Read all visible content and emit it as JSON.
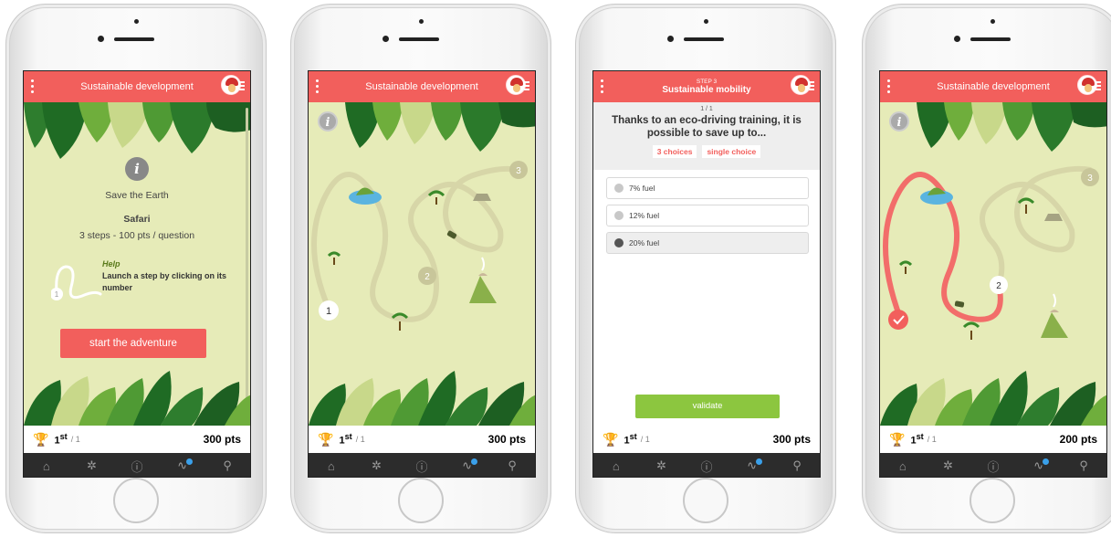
{
  "colors": {
    "accent": "#f25f5c",
    "scene": "#e6ebb8",
    "validate": "#8cc63f",
    "path_done": "#f26d6a"
  },
  "icons": {
    "menu": "menu-dots-icon",
    "avatar": "avatar-icon",
    "info": "info-icon",
    "trophy": "trophy-icon",
    "nav": [
      "home-icon",
      "network-icon",
      "help-icon",
      "activity-icon",
      "search-icon"
    ]
  },
  "screens": {
    "intro": {
      "header_title": "Sustainable development",
      "line1": "Save the Earth",
      "line2": "Safari",
      "line3": "3 steps - 100 pts / question",
      "help_title": "Help",
      "help_text": "Launch a step by clicking on its number",
      "help_step": "1",
      "start_button": "start the adventure",
      "rank": "1",
      "rank_suffix": "st",
      "rank_total": "/ 1",
      "points": "300 pts"
    },
    "map": {
      "header_title": "Sustainable development",
      "steps": [
        "1",
        "2",
        "3"
      ],
      "rank": "1",
      "rank_suffix": "st",
      "rank_total": "/ 1",
      "points": "300 pts"
    },
    "quiz": {
      "step_label": "STEP 3",
      "header_title": "Sustainable mobility",
      "counter": "1 / 1",
      "question": "Thanks to an eco-driving training, it is possible to save up to...",
      "tags": [
        "3 choices",
        "single choice"
      ],
      "options": [
        {
          "label": "7% fuel",
          "selected": false
        },
        {
          "label": "12% fuel",
          "selected": false
        },
        {
          "label": "20% fuel",
          "selected": true
        }
      ],
      "validate_button": "validate",
      "rank": "1",
      "rank_suffix": "st",
      "rank_total": "/ 1",
      "points": "300 pts"
    },
    "map_progress": {
      "header_title": "Sustainable development",
      "steps": [
        "2",
        "3"
      ],
      "rank": "1",
      "rank_suffix": "st",
      "rank_total": "/ 1",
      "points": "200 pts"
    }
  }
}
